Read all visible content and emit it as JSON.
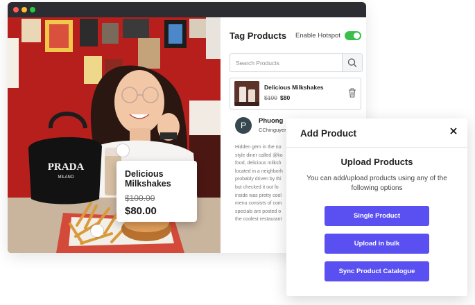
{
  "window": {
    "controls": [
      "close",
      "minimize",
      "maximize"
    ]
  },
  "photo": {
    "bag_brand": "PRADA",
    "bag_city": "MILANO"
  },
  "tag_card": {
    "name": "Delicious Milkshakes",
    "old_price": "$100.00",
    "price": "$80.00"
  },
  "panel": {
    "title": "Tag Products",
    "hotspot_label": "Enable Hotspot",
    "hotspot_enabled": true,
    "search_placeholder": "Search Products",
    "search_icon": "search-icon",
    "product": {
      "name": "Delicious Milkshakes",
      "old_price": "$100",
      "price": "$80",
      "delete_icon": "trash-icon"
    },
    "post": {
      "avatar_letter": "P",
      "name": "Phuong",
      "handle": "CChinguyer",
      "caption_lines": [
        "Hidden gem in the no",
        "style diner called @ko",
        "food, delicious milksh",
        "located in a neighborh",
        "probably driven by thi",
        "but checked it out fo",
        "inside was pretty cool",
        "menu consists of com",
        "specials are posted o",
        "the coolest restaurant"
      ]
    }
  },
  "modal": {
    "title": "Add Product",
    "close_icon": "close-icon",
    "heading": "Upload Products",
    "description": "You can add/upload products using any of the following options",
    "buttons": [
      "Single Product",
      "Upload in bulk",
      "Sync Product Catalogue"
    ]
  },
  "colors": {
    "accent": "#5a4ff0",
    "toggle_on": "#3bbf4a",
    "titlebar": "#2b2d33",
    "wall_red": "#b71f1d"
  }
}
